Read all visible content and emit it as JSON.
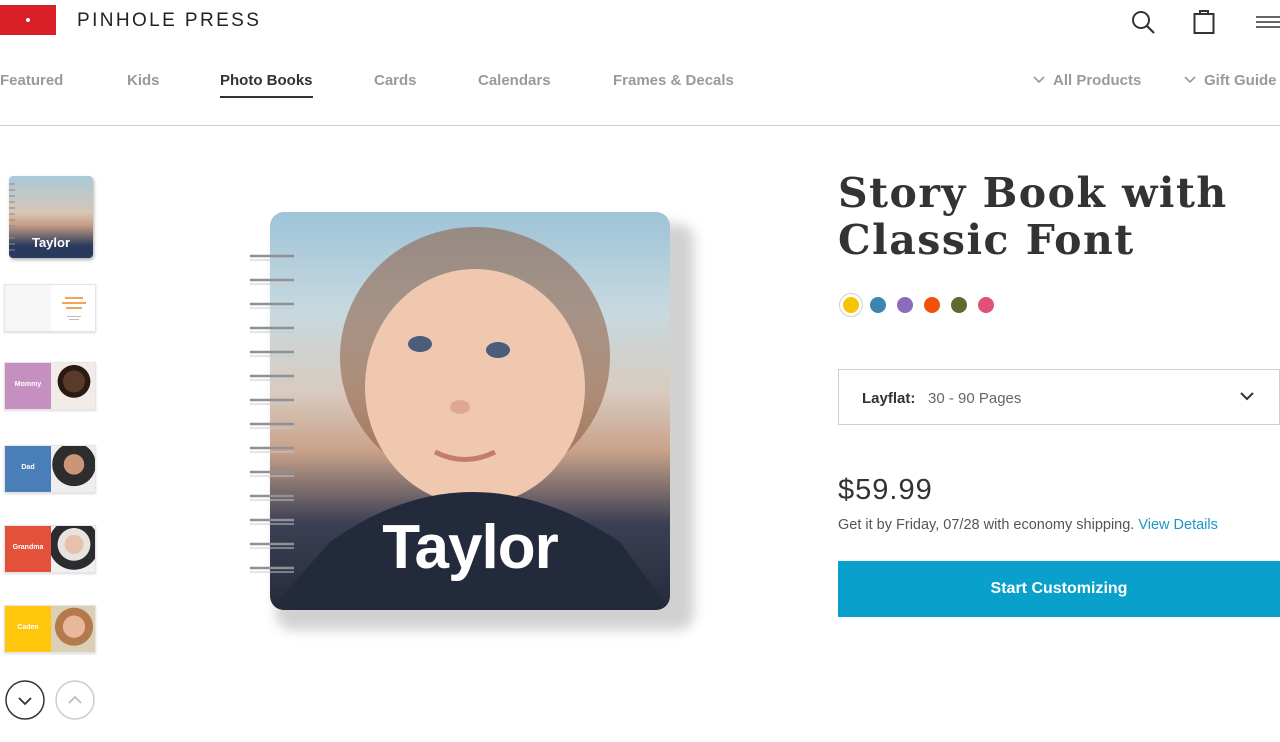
{
  "brand": {
    "name": "PINHOLE PRESS",
    "color": "#d71f25"
  },
  "header_icons": [
    "search-icon",
    "cart-icon",
    "menu-icon"
  ],
  "nav": {
    "items": [
      {
        "label": "Featured",
        "active": false
      },
      {
        "label": "Kids",
        "active": false
      },
      {
        "label": "Photo Books",
        "active": true
      },
      {
        "label": "Cards",
        "active": false
      },
      {
        "label": "Calendars",
        "active": false
      },
      {
        "label": "Frames & Decals",
        "active": false
      }
    ],
    "dropdowns": [
      {
        "label": "All Products"
      },
      {
        "label": "Gift Guide"
      }
    ]
  },
  "thumbnails": [
    {
      "label": "Taylor",
      "color": "#2a3a5c"
    },
    {
      "label": "",
      "color": "#f3f3f3"
    },
    {
      "label": "Mommy",
      "color": "#c58fc0"
    },
    {
      "label": "Dad",
      "color": "#4a7eb9"
    },
    {
      "label": "Grandma",
      "color": "#e4513a"
    },
    {
      "label": "Caden",
      "color": "#ffc60b"
    }
  ],
  "product": {
    "title": "Story Book with Classic Font",
    "cover_name": "Taylor",
    "swatches": [
      {
        "name": "yellow",
        "color": "#f6c400",
        "selected": true
      },
      {
        "name": "blue",
        "color": "#3a86b0",
        "selected": false
      },
      {
        "name": "purple",
        "color": "#8c6bb8",
        "selected": false
      },
      {
        "name": "orange",
        "color": "#f0520c",
        "selected": false
      },
      {
        "name": "olive",
        "color": "#5d6b2e",
        "selected": false
      },
      {
        "name": "pink",
        "color": "#e0507a",
        "selected": false
      }
    ],
    "option": {
      "label": "Layflat:",
      "value": "30 - 90 Pages"
    },
    "price": "$59.99",
    "shipping_text": "Get it by Friday, 07/28 with economy shipping.",
    "shipping_link": "View Details",
    "cta": "Start Customizing",
    "accent": "#0aa0cc"
  }
}
